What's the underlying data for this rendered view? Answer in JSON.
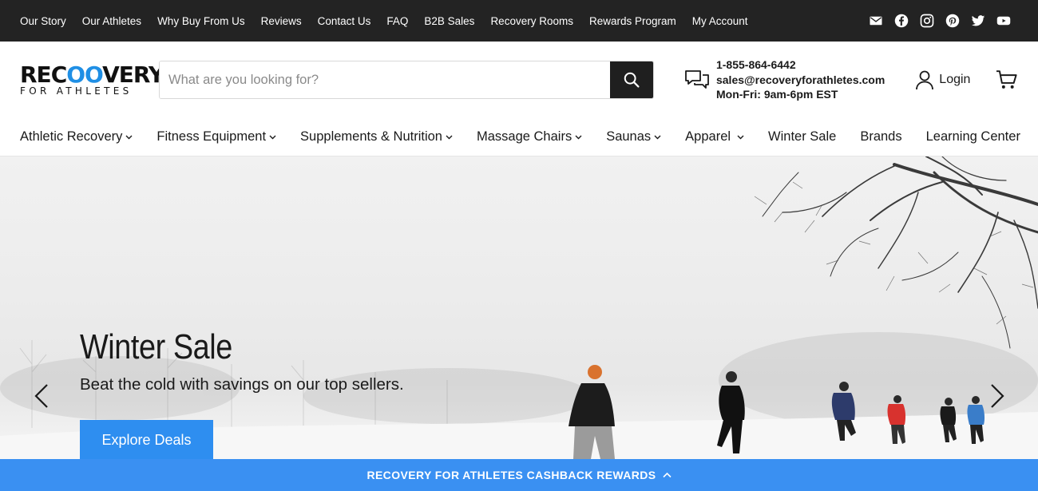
{
  "topbar": {
    "links": [
      "Our Story",
      "Our Athletes",
      "Why Buy From Us",
      "Reviews",
      "Contact Us",
      "FAQ",
      "B2B Sales",
      "Recovery Rooms",
      "Rewards Program",
      "My Account"
    ],
    "social": [
      "email-icon",
      "facebook-icon",
      "instagram-icon",
      "pinterest-icon",
      "twitter-icon",
      "youtube-icon"
    ]
  },
  "header": {
    "logo_main_pre": "REC",
    "logo_main_oo": "OO",
    "logo_main_post": "VERY",
    "logo_sub": "FOR ATHLETES",
    "search_placeholder": "What are you looking for?",
    "phone": "1-855-864-6442",
    "email": "sales@recoveryforathletes.com",
    "hours": "Mon-Fri: 9am-6pm EST",
    "login_label": "Login"
  },
  "nav": {
    "items": [
      {
        "label": "Athletic Recovery",
        "dropdown": true
      },
      {
        "label": "Fitness Equipment",
        "dropdown": true
      },
      {
        "label": "Supplements & Nutrition",
        "dropdown": true
      },
      {
        "label": "Massage Chairs",
        "dropdown": true
      },
      {
        "label": "Saunas",
        "dropdown": true
      },
      {
        "label": "Apparel",
        "dropdown": true
      },
      {
        "label": "Winter Sale",
        "dropdown": false
      },
      {
        "label": "Brands",
        "dropdown": false
      },
      {
        "label": "Learning Center",
        "dropdown": false
      }
    ]
  },
  "hero": {
    "title": "Winter Sale",
    "subtitle": "Beat the cold with savings on our top sellers.",
    "cta": "Explore Deals"
  },
  "rewards_bar": {
    "label": "RECOVERY FOR ATHLETES CASHBACK REWARDS"
  },
  "colors": {
    "topbar": "#232323",
    "accent_blue": "#2e8ef0",
    "rewards_blue": "#3a90f2",
    "logo_blue": "#1f8fe5"
  }
}
